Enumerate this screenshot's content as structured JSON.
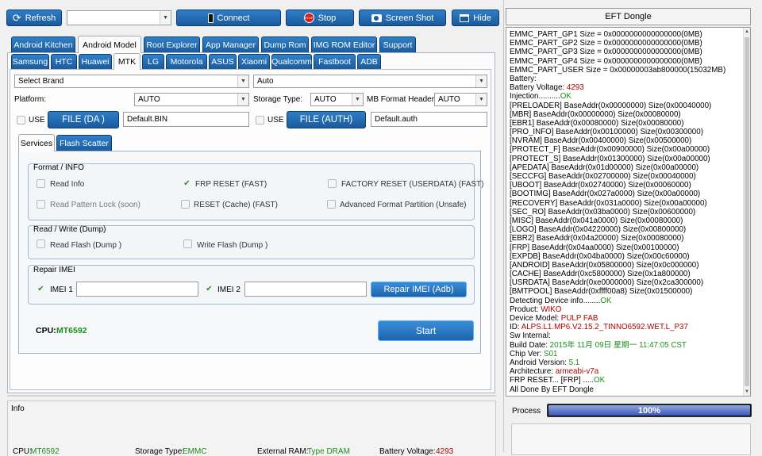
{
  "toolbar": {
    "refresh": "Refresh",
    "connect": "Connect",
    "stop": "Stop",
    "screenshot": "Screen Shot",
    "hide": "Hide",
    "device_combo_value": ""
  },
  "tabs_main": [
    "Android Kitchen",
    "Android Model",
    "Root Explorer",
    "App Manager",
    "Dump Rom",
    "IMG ROM Editor",
    "Support"
  ],
  "tabs_brand": [
    "Samsung",
    "HTC",
    "Huawei",
    "MTK",
    "LG",
    "Motorola",
    "ASUS",
    "Xiaomi",
    "Qualcomm",
    "Fastboot",
    "ADB"
  ],
  "config": {
    "brand": "Select Brand",
    "model": "Auto",
    "platform_label": "Platform:",
    "platform_value": "AUTO",
    "storage_label": "Storage Type:",
    "storage_value": "AUTO",
    "mb_label": "MB Format Header",
    "mb_value": "AUTO",
    "use1": "USE",
    "file_da": "FILE (DA )",
    "da_value": "Default.BIN",
    "use2": "USE",
    "file_auth": "FILE (AUTH)",
    "auth_value": "Default.auth"
  },
  "subtabs": [
    "Services",
    "Flash Scatter"
  ],
  "format": {
    "title": "Format / INFO",
    "read_info": "Read Info",
    "frp": "FRP RESET (FAST)",
    "factory": "FACTORY RESET (USERDATA) (FAST)",
    "read_pattern": "Read Pattern Lock (soon)",
    "reset_cache": "RESET (Cache) (FAST)",
    "adv_format": "Advanced Format Partition (Unsafe)"
  },
  "rw": {
    "title": "Read / Write (Dump)",
    "read_flash": "Read Flash (Dump )",
    "write_flash": "Write Flash (Dump )"
  },
  "imei": {
    "title": "Repair IMEI",
    "imei1": "IMEI 1",
    "imei2": "IMEI 2",
    "imei1_value": "",
    "imei2_value": "",
    "repair_button": "Repair IMEI (Adb)"
  },
  "cpu": {
    "label": "CPU:",
    "value": "MT6592"
  },
  "start": "Start",
  "info": {
    "title": "Info",
    "cpu_label": "CPU:",
    "cpu_value": "MT6592",
    "storage_label": "Storage Type:",
    "storage_value": "EMMC",
    "ram_label": "External RAM:",
    "ram_value": "Type DRAM",
    "battery_label": "Battery Voltage:",
    "battery_value": "4293"
  },
  "right": {
    "title": "EFT Dongle",
    "process_label": "Process",
    "progress": 100,
    "progress_text": "100%"
  },
  "colors": {
    "ok_green": "#1a9a1a",
    "val_red": "#b00000",
    "val_green": "#1c8e1c"
  },
  "log": [
    {
      "t": "EMMC_PART_GP1 Size = 0x0000000000000000(0MB)"
    },
    {
      "t": "EMMC_PART_GP2 Size = 0x0000000000000000(0MB)"
    },
    {
      "t": "EMMC_PART_GP3 Size = 0x0000000000000000(0MB)"
    },
    {
      "t": "EMMC_PART_GP4 Size = 0x0000000000000000(0MB)"
    },
    {
      "t": "EMMC_PART_USER Size = 0x00000003ab800000(15032MB)"
    },
    {
      "t": "Battery:"
    },
    {
      "t": "Battery Voltage: ",
      "v": "4293",
      "c": "red"
    },
    {
      "t": "Injection..........",
      "v": "OK",
      "c": "green"
    },
    {
      "t": "[PRELOADER] BaseAddr(0x00000000) Size(0x00040000)"
    },
    {
      "t": "[MBR] BaseAddr(0x00000000) Size(0x00080000)"
    },
    {
      "t": "[EBR1] BaseAddr(0x00080000) Size(0x00080000)"
    },
    {
      "t": "[PRO_INFO] BaseAddr(0x00100000) Size(0x00300000)"
    },
    {
      "t": "[NVRAM] BaseAddr(0x00400000) Size(0x00500000)"
    },
    {
      "t": "[PROTECT_F] BaseAddr(0x00900000) Size(0x00a00000)"
    },
    {
      "t": "[PROTECT_S] BaseAddr(0x01300000) Size(0x00a00000)"
    },
    {
      "t": "[APEDATA] BaseAddr(0x01d00000) Size(0x00a00000)"
    },
    {
      "t": "[SECCFG] BaseAddr(0x02700000) Size(0x00040000)"
    },
    {
      "t": "[UBOOT] BaseAddr(0x02740000) Size(0x00060000)"
    },
    {
      "t": "[BOOTIMG] BaseAddr(0x027a0000) Size(0x00a00000)"
    },
    {
      "t": "[RECOVERY] BaseAddr(0x031a0000) Size(0x00a00000)"
    },
    {
      "t": "[SEC_RO] BaseAddr(0x03ba0000) Size(0x00600000)"
    },
    {
      "t": "[MISC] BaseAddr(0x041a0000) Size(0x00080000)"
    },
    {
      "t": "[LOGO] BaseAddr(0x04220000) Size(0x00800000)"
    },
    {
      "t": "[EBR2] BaseAddr(0x04a20000) Size(0x00080000)"
    },
    {
      "t": "[FRP] BaseAddr(0x04aa0000) Size(0x00100000)"
    },
    {
      "t": "[EXPDB] BaseAddr(0x04ba0000) Size(0x00c60000)"
    },
    {
      "t": "[ANDROID] BaseAddr(0x05800000) Size(0x0c000000)"
    },
    {
      "t": "[CACHE] BaseAddr(0xc5800000) Size(0x1a800000)"
    },
    {
      "t": "[USRDATA] BaseAddr(0xe0000000) Size(0x2ca300000)"
    },
    {
      "t": "[BMTPOOL] BaseAddr(0xffff00a8) Size(0x01500000)"
    },
    {
      "t": "Detecting Device info........",
      "v": "OK",
      "c": "green"
    },
    {
      "t": "Product: ",
      "v": "WIKO",
      "c": "red"
    },
    {
      "t": "Device Model: ",
      "v": "PULP FAB",
      "c": "red"
    },
    {
      "t": "ID: ",
      "v": "ALPS.L1.MP6.V2.15.2_TINNO6592.WET.L_P37",
      "c": "red"
    },
    {
      "t": "Sw Internal:"
    },
    {
      "t": "Build Date: ",
      "v": "2015年 11月 09日 星期一 11:47:05 CST",
      "c": "green"
    },
    {
      "t": "Chip Ver: ",
      "v": "S01",
      "c": "green"
    },
    {
      "t": "Android Version: ",
      "v": "5.1",
      "c": "green"
    },
    {
      "t": "Architecture: ",
      "v": "armeabi-v7a",
      "c": "red"
    },
    {
      "t": "FRP RESET... [FRP] .....",
      "v": "OK",
      "c": "green"
    },
    {
      "t": "All Done By EFT Dongle"
    }
  ]
}
